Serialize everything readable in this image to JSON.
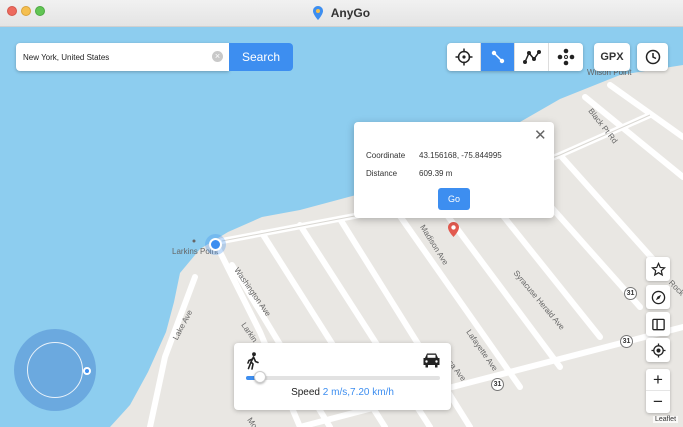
{
  "window": {
    "title": "AnyGo"
  },
  "search": {
    "value": "New York, United States",
    "button_label": "Search"
  },
  "toolbar": {
    "gpx_label": "GPX"
  },
  "popup": {
    "coordinate_label": "Coordinate",
    "coordinate_value": "43.156168, -75.844995",
    "distance_label": "Distance",
    "distance_value": "609.39 m",
    "go_label": "Go"
  },
  "speed": {
    "label": "Speed",
    "value": "2 m/s,7.20 km/h",
    "slider_fraction": 0.07
  },
  "map": {
    "attribution": "Leaflet",
    "place_labels": {
      "wilson_point": "Wilson Point",
      "larkins_point": "Larkins Point"
    },
    "street_labels": {
      "black_pt_rd": "Black Pt Rd",
      "madison_ave": "Madison Ave",
      "syracuse_herald_ave": "Syracuse Herald Ave",
      "washington_ave": "Washington Ave",
      "larkin_ave": "Larkin Ave",
      "lake_ave": "Lake Ave",
      "lafayette_ave": "Lafayette Ave",
      "seneca_ave": "Seneca Ave",
      "rock_rd": "Rock Rd",
      "monroe_ave_partial": "Mo"
    },
    "route_badges": [
      "31",
      "31",
      "31"
    ]
  },
  "colors": {
    "accent": "#3d8ef0",
    "water": "#8dcdef",
    "land": "#e9e7e3",
    "road": "#ffffff"
  }
}
